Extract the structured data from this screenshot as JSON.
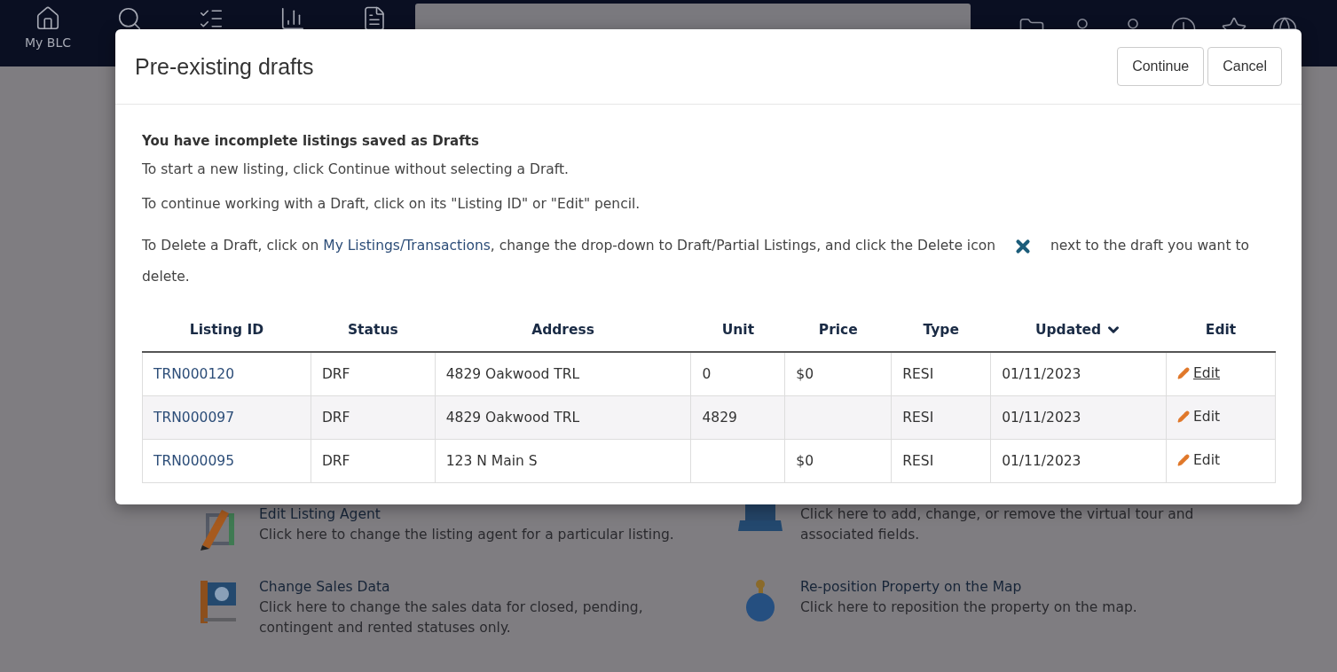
{
  "nav": {
    "left": [
      {
        "label": "My BLC"
      }
    ]
  },
  "background_items": [
    {
      "title": "Edit Listing Agent",
      "description": "Click here to change the listing agent for a particular listing."
    },
    {
      "description": "Click here to add, change, or remove the virtual tour and associated fields."
    },
    {
      "title": "Change Sales Data",
      "description": "Click here to change the sales data for closed, pending, contingent and rented statuses only."
    },
    {
      "title": "Re-position Property on the Map",
      "description": "Click here to reposition the property on the map."
    }
  ],
  "dialog": {
    "title": "Pre-existing drafts",
    "buttons": [
      "Continue",
      "Cancel"
    ],
    "heading": "You have incomplete listings saved as Drafts",
    "paragraphs": [
      "To start a new listing, click Continue without selecting a Draft.",
      "To continue working with a Draft, click on its \"Listing ID\" or \"Edit\" pencil."
    ],
    "delete_note": {
      "before": "To Delete a Draft, click on",
      "link": "My Listings/Transactions",
      "middle": ", change the drop-down to Draft/Partial Listings, and click the Delete icon",
      "after": "next to the draft you want to delete."
    },
    "table": {
      "columns": [
        {
          "label": "Listing ID",
          "sorted": false
        },
        {
          "label": "Status",
          "sorted": false
        },
        {
          "label": "Address",
          "sorted": false
        },
        {
          "label": "Unit",
          "sorted": false
        },
        {
          "label": "Price",
          "sorted": false
        },
        {
          "label": "Type",
          "sorted": false
        },
        {
          "label": "Updated",
          "sorted": true
        },
        {
          "label": "Edit",
          "sorted": false
        }
      ],
      "rows": [
        {
          "listing_id": "TRN000120",
          "status": "DRF",
          "address": "4829 Oakwood TRL",
          "unit": "0",
          "price": "$0",
          "type": "RESI",
          "updated": "01/11/2023",
          "edit": "Edit",
          "hovered": true
        },
        {
          "listing_id": "TRN000097",
          "status": "DRF",
          "address": "4829 Oakwood TRL",
          "unit": "4829",
          "type": "RESI",
          "updated": "01/11/2023",
          "edit": "Edit",
          "hovered": false
        },
        {
          "listing_id": "TRN000095",
          "status": "DRF",
          "address": "123 N Main S",
          "price": "$0",
          "type": "RESI",
          "updated": "01/11/2023",
          "edit": "Edit",
          "hovered": false
        }
      ]
    }
  }
}
